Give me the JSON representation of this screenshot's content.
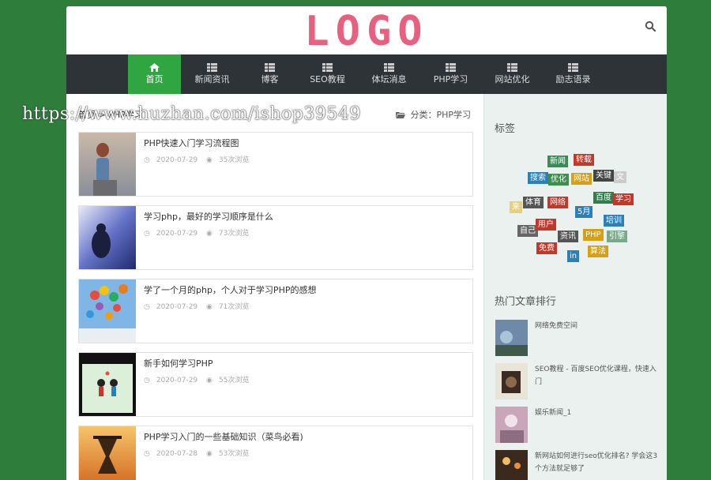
{
  "header": {
    "logo": "LOGO"
  },
  "nav": [
    {
      "label": "首页",
      "active": true
    },
    {
      "label": "新闻资讯"
    },
    {
      "label": "博客"
    },
    {
      "label": "SEO教程"
    },
    {
      "label": "体坛消息"
    },
    {
      "label": "PHP学习"
    },
    {
      "label": "网站优化"
    },
    {
      "label": "励志语录"
    }
  ],
  "breadcrumb": "首页 > PHP学习",
  "category": "分类：PHP学习",
  "posts": [
    {
      "title": "PHP快速入门学习流程图",
      "date": "2020-07-29",
      "views": "35次浏览"
    },
    {
      "title": "学习php，最好的学习顺序是什么",
      "date": "2020-07-29",
      "views": "73次浏览"
    },
    {
      "title": "学了一个月的php，个人对于学习PHP的感想",
      "date": "2020-07-29",
      "views": "71次浏览"
    },
    {
      "title": "新手如何学习PHP",
      "date": "2020-07-29",
      "views": "55次浏览"
    },
    {
      "title": "PHP学习入门的一些基础知识（菜鸟必看)",
      "date": "2020-07-28",
      "views": "53次浏览"
    }
  ],
  "sidebar": {
    "tags_title": "标签",
    "tags": [
      "新闻",
      "转载",
      "搜索",
      "优化",
      "网站",
      "关键",
      "文",
      "百度",
      "学习",
      "来",
      "体育",
      "网络",
      "5月",
      "自己",
      "用户",
      "培训",
      "资讯",
      "PHP",
      "引擎",
      "免费",
      "in",
      "算法"
    ],
    "hot_title": "热门文章排行",
    "hot": [
      {
        "title": "网络免费空间"
      },
      {
        "title": "SEO教程 - 百度SEO优化课程，快速入门"
      },
      {
        "title": "娱乐新闻_1"
      },
      {
        "title": "新网站如何进行seo优化排名? 学会这3个方法就足够了"
      }
    ]
  },
  "watermark": "https://www.huzhan.com/ishop39549",
  "colors": {
    "accent": "#2fa642",
    "nav_bg": "#2e3338",
    "logo": "#e8607f",
    "page_bg": "#2e7d3a"
  }
}
